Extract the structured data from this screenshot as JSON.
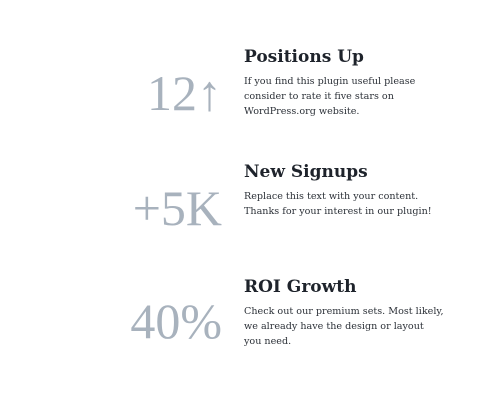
{
  "stats": [
    {
      "value": "12↑",
      "title": "Positions Up",
      "description": "If you find this plugin useful please consider to rate it five stars on WordPress.org website."
    },
    {
      "value": "+5K",
      "title": "New Signups",
      "description": "Replace this text with your content. Thanks for your interest in our plugin!"
    },
    {
      "value": "40%",
      "title": "ROI Growth",
      "description": "Check out our premium sets. Most likely, we already have the design or layout you need."
    }
  ]
}
